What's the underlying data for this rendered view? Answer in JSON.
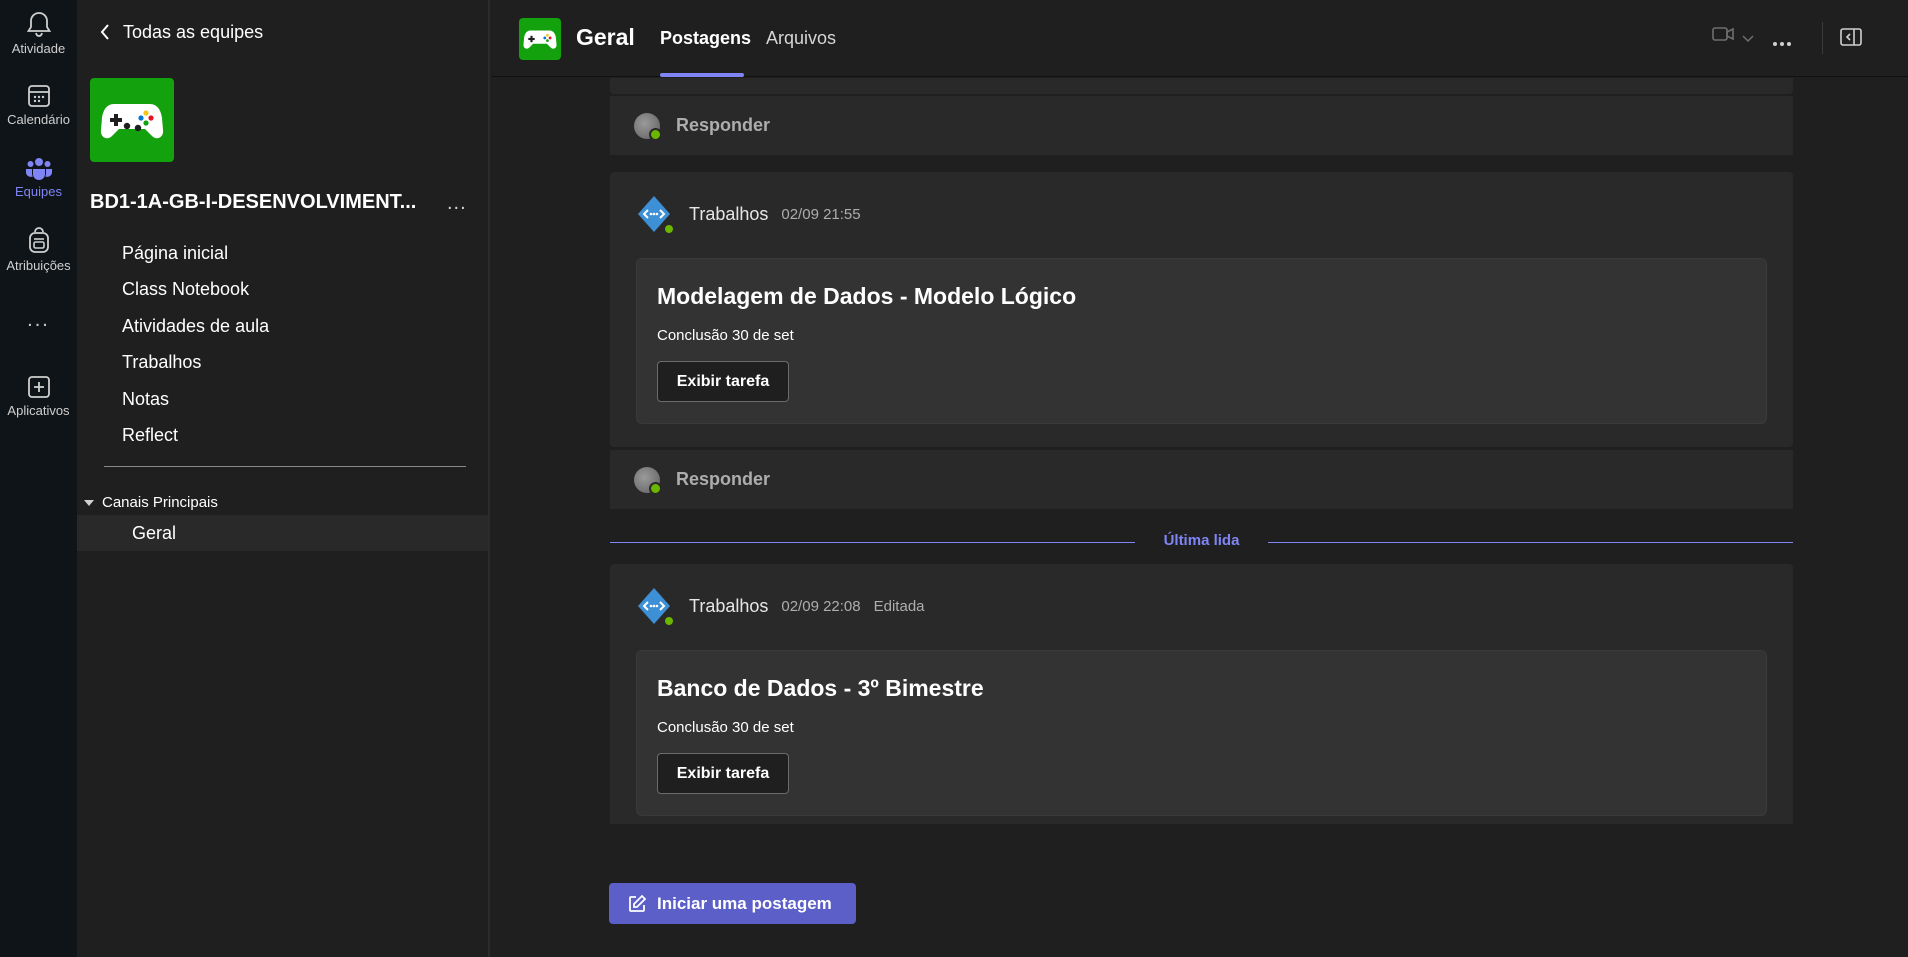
{
  "rail": {
    "items": [
      {
        "label": "Atividade",
        "icon": "bell-icon"
      },
      {
        "label": "Calendário",
        "icon": "calendar-icon"
      },
      {
        "label": "Equipes",
        "icon": "teams-icon"
      },
      {
        "label": "Atribuições",
        "icon": "backpack-icon"
      },
      {
        "label": "...",
        "icon": "more-icon"
      },
      {
        "label": "Aplicativos",
        "icon": "add-apps-icon"
      }
    ],
    "active": "Equipes"
  },
  "team": {
    "back_label": "Todas as equipes",
    "name": "BD1-1A-GB-I-DESENVOLVIMENT...",
    "more": "...",
    "nav": [
      "Página inicial",
      "Class Notebook",
      "Atividades de aula",
      "Trabalhos",
      "Notas",
      "Reflect"
    ],
    "channel_group": "Canais Principais",
    "channels": [
      "Geral"
    ]
  },
  "header": {
    "channel": "Geral",
    "tabs": [
      "Postagens",
      "Arquivos"
    ],
    "active_tab": "Postagens"
  },
  "feed": {
    "reply_label": "Responder",
    "last_read": "Última lida",
    "posts": [
      {
        "author": "Trabalhos",
        "timestamp": "02/09 21:55",
        "edited": "",
        "task_title": "Modelagem de Dados - Modelo Lógico",
        "due": "Conclusão 30 de set",
        "button": "Exibir tarefa"
      },
      {
        "author": "Trabalhos",
        "timestamp": "02/09 22:08",
        "edited": "Editada",
        "task_title": "Banco de Dados - 3º Bimestre",
        "due": "Conclusão 30 de set",
        "button": "Exibir tarefa"
      }
    ],
    "new_post_label": "Iniciar uma postagem"
  },
  "colors": {
    "accent": "#7f85f5",
    "button": "#5b5fc7",
    "team_green": "#13a10e",
    "presence": "#6bb700"
  }
}
